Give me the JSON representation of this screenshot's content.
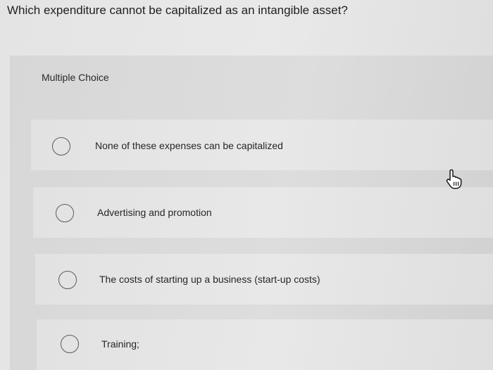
{
  "question": {
    "text": "Which expenditure cannot be capitalized as an intangible asset?"
  },
  "answer_area": {
    "label": "Multiple Choice",
    "options": [
      {
        "label": "None of these expenses can be capitalized",
        "selected": false
      },
      {
        "label": "Advertising and promotion",
        "selected": false
      },
      {
        "label": "The costs of starting up a business (start-up costs)",
        "selected": false
      },
      {
        "label": "Training;",
        "selected": false
      }
    ]
  },
  "icons": {
    "radio": "radio-button-icon",
    "cursor": "hand-pointer-cursor-icon"
  }
}
